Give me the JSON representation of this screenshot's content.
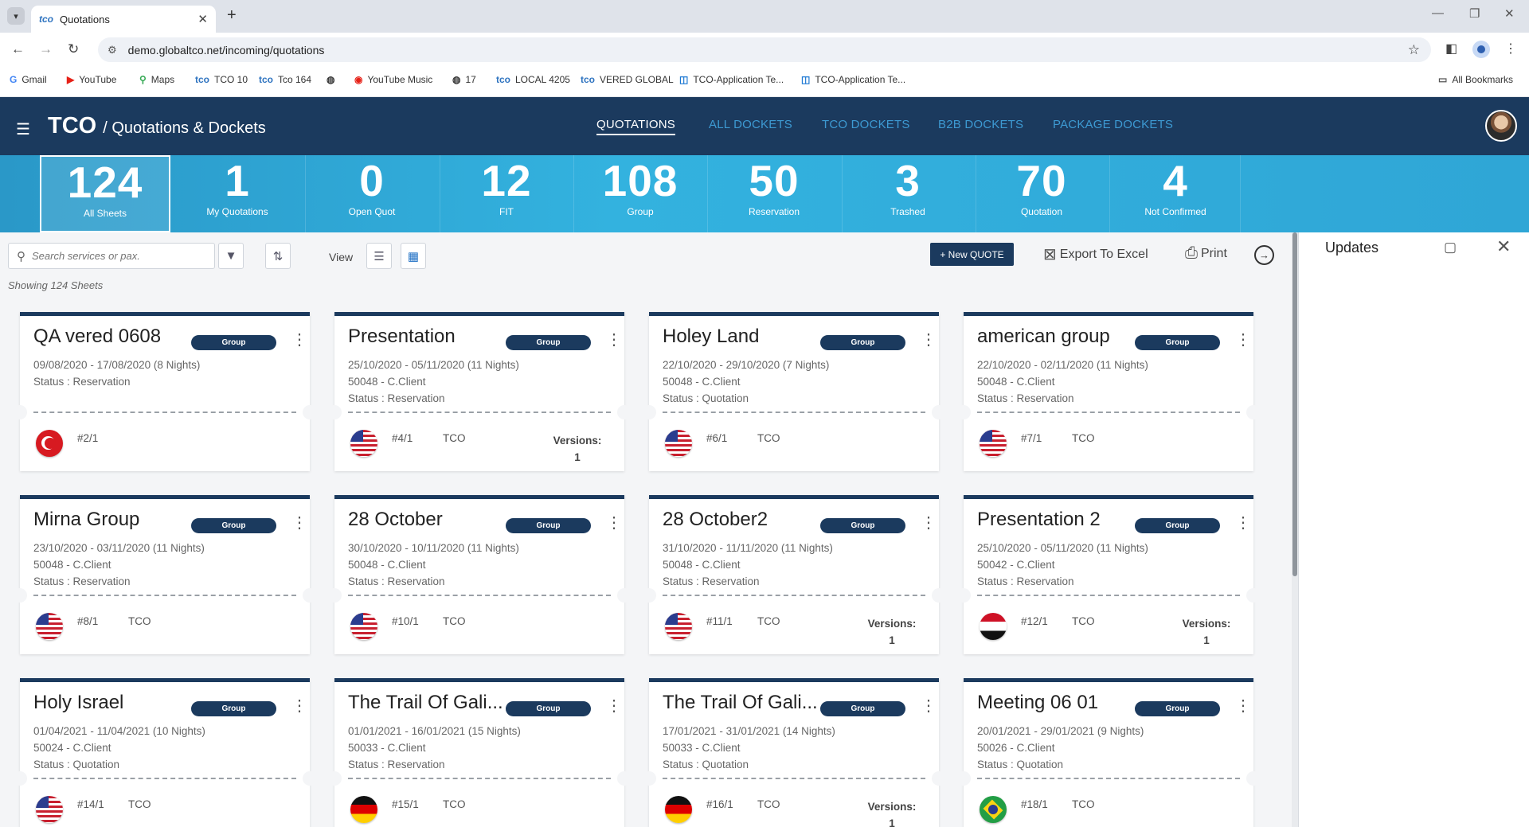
{
  "browser": {
    "tab_title": "Quotations",
    "tab_favicon": "tco",
    "url": "demo.globaltco.net/incoming/quotations",
    "bookmarks": [
      {
        "label": "Gmail",
        "icon": "G"
      },
      {
        "label": "YouTube",
        "icon": "▶"
      },
      {
        "label": "Maps",
        "icon": "⚲"
      },
      {
        "label": "TCO 10",
        "icon": "tco"
      },
      {
        "label": "Tco 164",
        "icon": "tco"
      },
      {
        "label": "",
        "icon": "◍"
      },
      {
        "label": "YouTube Music",
        "icon": "◉"
      },
      {
        "label": "17",
        "icon": "◍"
      },
      {
        "label": "LOCAL 4205",
        "icon": "tco"
      },
      {
        "label": "VERED GLOBAL",
        "icon": "tco"
      },
      {
        "label": "TCO-Application Te...",
        "icon": "◫"
      },
      {
        "label": "TCO-Application Te...",
        "icon": "◫"
      }
    ],
    "all_bookmarks": "All Bookmarks"
  },
  "app": {
    "brand": "TCO",
    "subtitle": "/ Quotations & Dockets",
    "nav": [
      {
        "label": "QUOTATIONS",
        "active": true
      },
      {
        "label": "ALL DOCKETS",
        "active": false
      },
      {
        "label": "TCO DOCKETS",
        "active": false
      },
      {
        "label": "B2B DOCKETS",
        "active": false
      },
      {
        "label": "PACKAGE DOCKETS",
        "active": false
      }
    ]
  },
  "stats": [
    {
      "value": "124",
      "label": "All Sheets",
      "active": true
    },
    {
      "value": "1",
      "label": "My Quotations"
    },
    {
      "value": "0",
      "label": "Open Quot"
    },
    {
      "value": "12",
      "label": "FIT"
    },
    {
      "value": "108",
      "label": "Group"
    },
    {
      "value": "50",
      "label": "Reservation"
    },
    {
      "value": "3",
      "label": "Trashed"
    },
    {
      "value": "70",
      "label": "Quotation"
    },
    {
      "value": "4",
      "label": "Not Confirmed"
    }
  ],
  "toolbar": {
    "search_placeholder": "Search services or pax.",
    "view_label": "View",
    "new_quote": "+ New QUOTE",
    "export": "Export To Excel",
    "print": "Print",
    "showing": "Showing 124 Sheets"
  },
  "cards": [
    {
      "title": "QA vered 0608",
      "badge": "Group",
      "dates": "09/08/2020 - 17/08/2020 (8 Nights)",
      "client": "",
      "status": "Status : Reservation",
      "flag": "tr",
      "ref": "#2/1",
      "owner": "",
      "versions_label": "",
      "versions": ""
    },
    {
      "title": "Presentation",
      "badge": "Group",
      "dates": "25/10/2020 - 05/11/2020 (11 Nights)",
      "client": "50048 - C.Client",
      "status": "Status : Reservation",
      "flag": "us",
      "ref": "#4/1",
      "owner": "TCO",
      "versions_label": "Versions:",
      "versions": "1"
    },
    {
      "title": "Holey Land",
      "badge": "Group",
      "dates": "22/10/2020 - 29/10/2020 (7 Nights)",
      "client": "50048 - C.Client",
      "status": "Status : Quotation",
      "flag": "us",
      "ref": "#6/1",
      "owner": "TCO",
      "versions_label": "",
      "versions": ""
    },
    {
      "title": "american group",
      "badge": "Group",
      "dates": "22/10/2020 - 02/11/2020 (11 Nights)",
      "client": "50048 - C.Client",
      "status": "Status : Reservation",
      "flag": "us",
      "ref": "#7/1",
      "owner": "TCO",
      "versions_label": "",
      "versions": ""
    },
    {
      "title": "Mirna Group",
      "badge": "Group",
      "dates": "23/10/2020 - 03/11/2020 (11 Nights)",
      "client": "50048 - C.Client",
      "status": "Status : Reservation",
      "flag": "us",
      "ref": "#8/1",
      "owner": "TCO",
      "versions_label": "",
      "versions": ""
    },
    {
      "title": "28 October",
      "badge": "Group",
      "dates": "30/10/2020 - 10/11/2020 (11 Nights)",
      "client": "50048 - C.Client",
      "status": "Status : Reservation",
      "flag": "us",
      "ref": "#10/1",
      "owner": "TCO",
      "versions_label": "",
      "versions": ""
    },
    {
      "title": "28 October2",
      "badge": "Group",
      "dates": "31/10/2020 - 11/11/2020 (11 Nights)",
      "client": "50048 - C.Client",
      "status": "Status : Reservation",
      "flag": "us",
      "ref": "#11/1",
      "owner": "TCO",
      "versions_label": "Versions:",
      "versions": "1"
    },
    {
      "title": "Presentation 2",
      "badge": "Group",
      "dates": "25/10/2020 - 05/11/2020 (11 Nights)",
      "client": "50042 - C.Client",
      "status": "Status : Reservation",
      "flag": "eg",
      "ref": "#12/1",
      "owner": "TCO",
      "versions_label": "Versions:",
      "versions": "1"
    },
    {
      "title": "Holy Israel",
      "badge": "Group",
      "dates": "01/04/2021 - 11/04/2021 (10 Nights)",
      "client": "50024 - C.Client",
      "status": "Status : Quotation",
      "flag": "us",
      "ref": "#14/1",
      "owner": "TCO",
      "versions_label": "",
      "versions": ""
    },
    {
      "title": "The Trail Of Gali...",
      "badge": "Group",
      "dates": "01/01/2021 - 16/01/2021 (15 Nights)",
      "client": "50033 - C.Client",
      "status": "Status : Reservation",
      "flag": "de",
      "ref": "#15/1",
      "owner": "TCO",
      "versions_label": "",
      "versions": ""
    },
    {
      "title": "The Trail Of Gali...",
      "badge": "Group",
      "dates": "17/01/2021 - 31/01/2021 (14 Nights)",
      "client": "50033 - C.Client",
      "status": "Status : Quotation",
      "flag": "de",
      "ref": "#16/1",
      "owner": "TCO",
      "versions_label": "Versions:",
      "versions": "1"
    },
    {
      "title": "Meeting 06 01",
      "badge": "Group",
      "dates": "20/01/2021 - 29/01/2021 (9 Nights)",
      "client": "50026 - C.Client",
      "status": "Status : Quotation",
      "flag": "br",
      "ref": "#18/1",
      "owner": "TCO",
      "versions_label": "",
      "versions": ""
    }
  ],
  "updates": {
    "title": "Updates"
  }
}
